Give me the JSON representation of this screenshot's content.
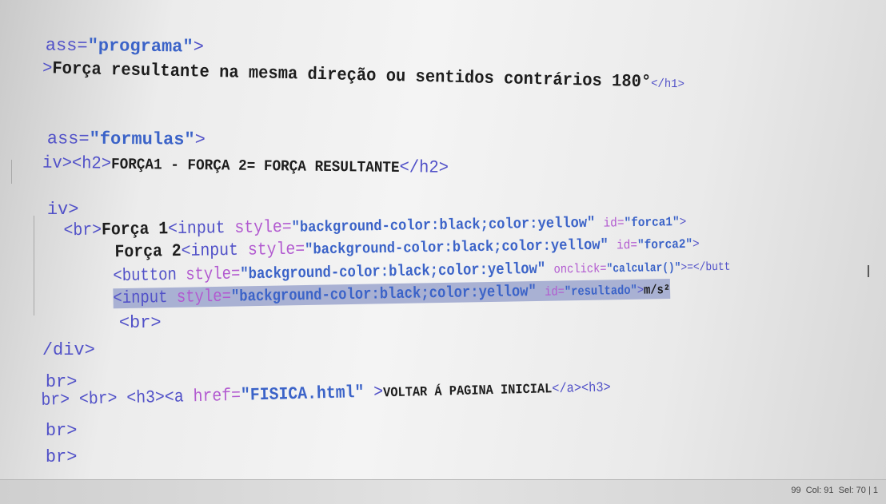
{
  "code": {
    "l1": [
      "ass=",
      "\"programa\"",
      ">"
    ],
    "l2": [
      ">",
      "Força resultante na mesma direção ou sentidos contrários 180°",
      "</h1>"
    ],
    "l3": [
      "ass=",
      "\"formulas\"",
      ">"
    ],
    "l4": [
      "iv><h2>",
      "FORÇA1 - FORÇA 2= FORÇA RESULTANTE",
      "</h2>"
    ],
    "l5": [
      "iv>"
    ],
    "l6": [
      "<br>",
      "Força 1",
      "<input ",
      "style=",
      "\"background-color:black;color:yellow\" ",
      "id=",
      "\"forca1\"",
      ">"
    ],
    "l7": [
      "Força 2",
      "<input ",
      "style=",
      "\"background-color:black;color:yellow\" ",
      "id=",
      "\"forca2\"",
      ">"
    ],
    "l8": [
      "<button ",
      "style=",
      "\"background-color:black;color:yellow\" ",
      "onclick=",
      "\"calcular()\"",
      ">=</butt"
    ],
    "l9": [
      "<input ",
      "style=",
      "\"background-color:black;color:yellow\" ",
      "id=",
      "\"resultado\"",
      ">",
      "m/s²"
    ],
    "l10": [
      "<br>"
    ],
    "l11": [
      "/div>"
    ],
    "l12": [
      "br>"
    ],
    "l13": [
      "br> ",
      "<br> <h3><a ",
      "href=",
      "\"FISICA.html\" ",
      ">",
      "VOLTAR Á PAGINA INICIAL",
      "</a><h3>"
    ],
    "l14": [
      "br>"
    ],
    "l15": [
      "br>"
    ]
  },
  "status": {
    "text": "99  Col: 91  Sel: 70 | 1"
  },
  "colors": {
    "tag": "#5151c8",
    "attribute": "#b25ad0",
    "string": "#3b63c8",
    "text": "#1d1d1d",
    "selection": "#a9b1d3"
  }
}
